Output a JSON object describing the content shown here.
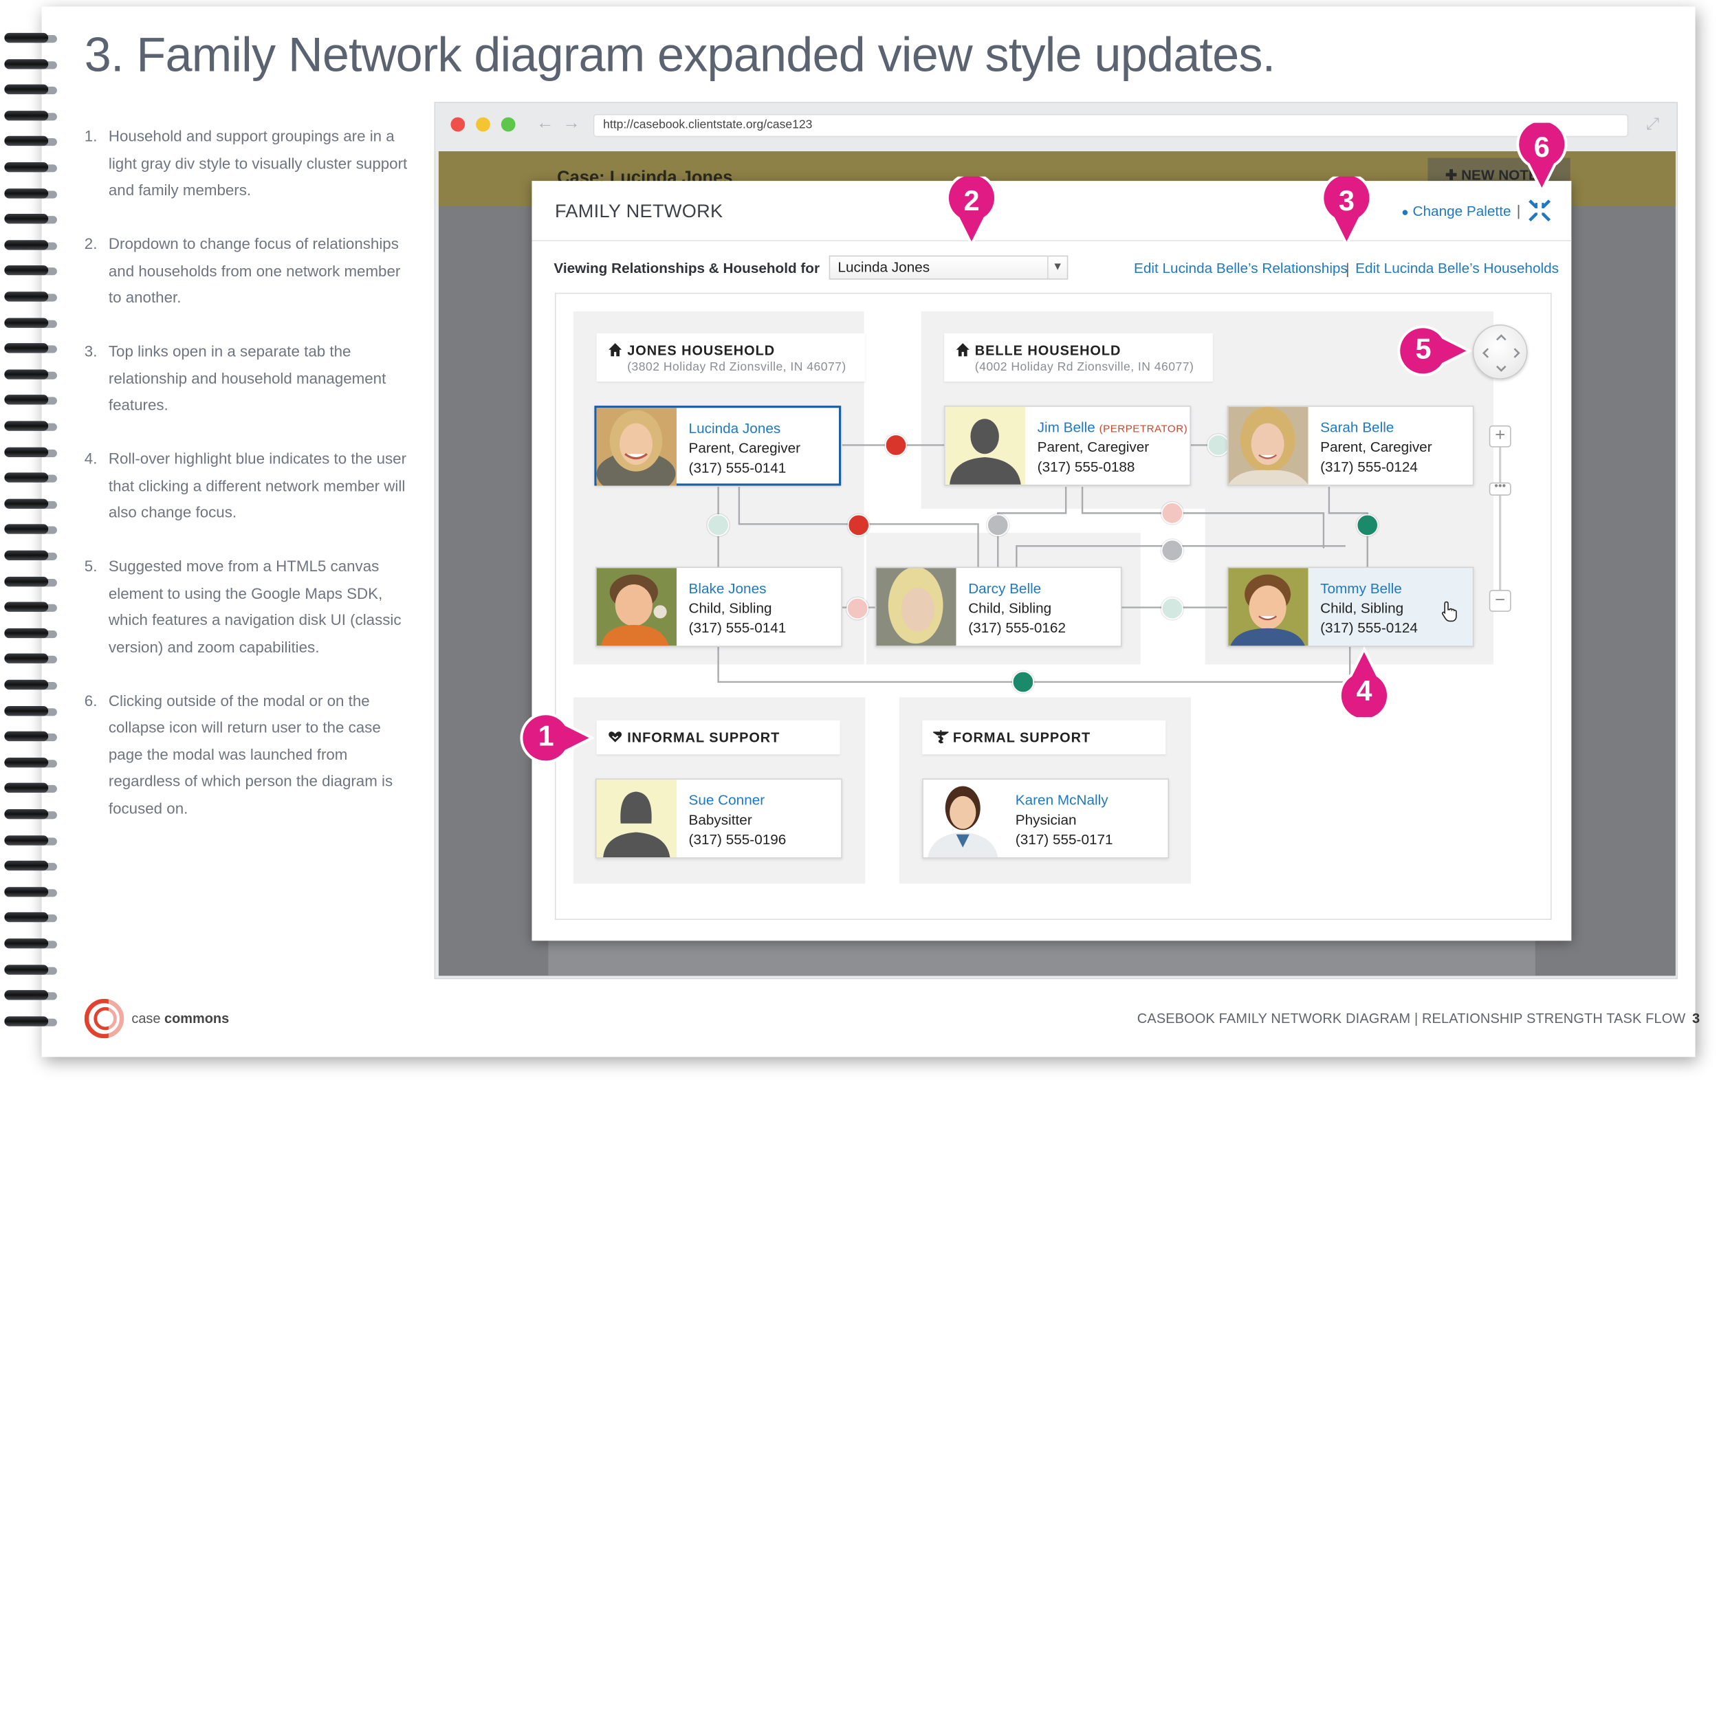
{
  "document": {
    "title": "3. Family Network diagram expanded view style updates.",
    "notes": [
      {
        "num": "1.",
        "text": "Household and support groupings are in a light gray div style to visually cluster support and family members."
      },
      {
        "num": "2.",
        "text": "Dropdown to change focus of relationships and households from one network member to another."
      },
      {
        "num": "3.",
        "text": "Top links open in a separate tab the relationship and household management features."
      },
      {
        "num": "4.",
        "text": "Roll-over highlight blue indicates to the user that clicking a different network member will also change focus."
      },
      {
        "num": "5.",
        "text": "Suggested move from a HTML5 canvas element to using the Google Maps SDK, which features a navigation disk UI (classic version) and zoom capabilities."
      },
      {
        "num": "6.",
        "text": "Clicking outside of the modal or on the collapse icon will return user to the case page the modal was launched from regardless of which person the diagram is focused on."
      }
    ],
    "footer": {
      "brand_light": "case",
      "brand_bold": "commons",
      "right_text": "CASEBOOK FAMILY NETWORK DIAGRAM | RELATIONSHIP STRENGTH TASK FLOW",
      "page_number": "3"
    }
  },
  "browser": {
    "url": "http://casebook.clientstate.org/case123",
    "nav_arrows": "←→",
    "dot_colors": [
      "#f0504a",
      "#f5c431",
      "#5dc74a"
    ]
  },
  "app": {
    "case_title": "Case: Lucinda Jones",
    "new_note_label": "✚ NEW NOTE"
  },
  "modal": {
    "title": "FAMILY NETWORK",
    "change_palette": "Change Palette",
    "separator": "|",
    "viewing_label": "Viewing Relationships & Household for",
    "selected_person": "Lucinda Jones",
    "edit_relationships": "Edit Lucinda Belle’s Relationships",
    "edit_households": "Edit Lucinda Belle’s Households",
    "groups": {
      "jones": {
        "title": "JONES HOUSEHOLD",
        "address": "(3802 Holiday Rd Zionsville, IN 46077)"
      },
      "belle": {
        "title": "BELLE HOUSEHOLD",
        "address": "(4002 Holiday Rd Zionsville, IN 46077)"
      },
      "informal": {
        "title": "INFORMAL SUPPORT"
      },
      "formal": {
        "title": "FORMAL SUPPORT"
      }
    },
    "people": {
      "lucinda": {
        "name": "Lucinda Jones",
        "role": "Parent, Caregiver",
        "phone": "(317) 555-0141"
      },
      "jim": {
        "name": "Jim Belle",
        "tag": "(PERPETRATOR)",
        "role": "Parent, Caregiver",
        "phone": "(317) 555-0188"
      },
      "sarah": {
        "name": "Sarah Belle",
        "role": "Parent, Caregiver",
        "phone": "(317) 555-0124"
      },
      "blake": {
        "name": "Blake Jones",
        "role": "Child, Sibling",
        "phone": "(317) 555-0141"
      },
      "darcy": {
        "name": "Darcy Belle",
        "role": "Child, Sibling",
        "phone": "(317) 555-0162"
      },
      "tommy": {
        "name": "Tommy Belle",
        "role": "Child, Sibling",
        "phone": "(317) 555-0124"
      },
      "sue": {
        "name": "Sue Conner",
        "role": "Babysitter",
        "phone": "(317) 555-0196"
      },
      "karen": {
        "name": "Karen McNally",
        "role": "Physician",
        "phone": "(317) 555-0171"
      }
    },
    "node_colors": {
      "strong_negative": "#d9352a",
      "positive": "#1a8a6a",
      "neutral": "#b9bbbe",
      "weak_negative": "#f3c6c1",
      "weak_positive": "#d3e8e0"
    },
    "zoom": {
      "plus": "+",
      "minus": "−"
    }
  },
  "callouts": [
    "1",
    "2",
    "3",
    "4",
    "5",
    "6"
  ],
  "callout_color": "#e01b84",
  "icons": [
    "home-icon",
    "heart-hand-icon",
    "caduceus-icon",
    "palette-icon",
    "collapse-icon",
    "expand-icon",
    "pointer-hand-icon",
    "navigation-disk-icon"
  ]
}
